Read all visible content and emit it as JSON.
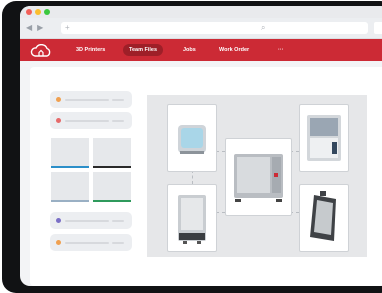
{
  "browser": {
    "traffic_lights": [
      "#f25f58",
      "#fbbe2e",
      "#3cc83f"
    ],
    "nav_back": "◀",
    "nav_forward": "▶",
    "new_tab": "+",
    "reload": "↻",
    "search": "⌕"
  },
  "app_nav": {
    "brand_color": "#cc2a35",
    "logo_icon": "cloud-printer-logo",
    "items": [
      {
        "label": "3D Printers"
      },
      {
        "label": "Team Files"
      },
      {
        "label": "Jobs"
      },
      {
        "label": "Work Order"
      },
      {
        "label": "···"
      }
    ],
    "active_item": "Team Files"
  },
  "sidebar_pills": [
    {
      "dot_color": "#f0a050"
    },
    {
      "dot_color": "#e66a6a"
    },
    {
      "dot_color": "#7a6fc6"
    },
    {
      "dot_color": "#f0a050"
    }
  ],
  "file_tiles": [
    {
      "accent": "#2c8fc9"
    },
    {
      "accent": "#2a2a2a"
    },
    {
      "accent": "#9ab0c4"
    },
    {
      "accent": "#2f9a5c"
    }
  ],
  "diagram": {
    "center": "main-printer",
    "nodes": [
      "compact-printer",
      "enclosed-printer",
      "large-printer",
      "tilted-printer"
    ]
  }
}
